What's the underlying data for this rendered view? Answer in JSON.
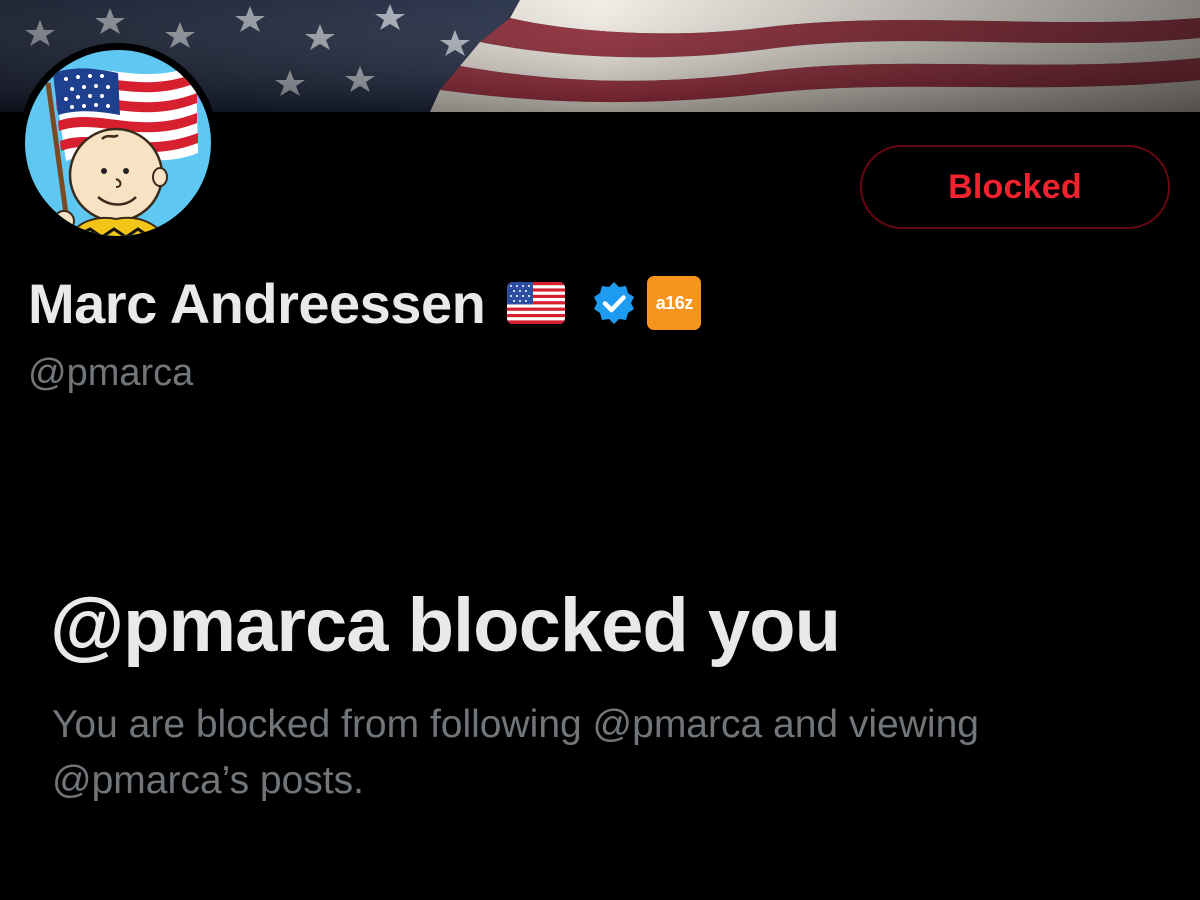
{
  "profile": {
    "display_name": "Marc Andreessen",
    "handle": "@pmarca",
    "verified": true,
    "affiliate_badge_text": "a16z"
  },
  "actions": {
    "blocked_button_label": "Blocked"
  },
  "block_notice": {
    "title": "@pmarca blocked you",
    "description": "You are blocked from following @pmarca and viewing @pmarca’s posts."
  },
  "icons": {
    "flag": "us-flag-emoji",
    "verified": "verified-checkmark-icon",
    "affiliate": "a16z-logo-badge"
  },
  "colors": {
    "background": "#000000",
    "primary_text": "#e7e9ea",
    "secondary_text": "#71767b",
    "blocked_red": "#f4212e",
    "blocked_border": "#67070f",
    "verified_blue": "#1d9bf0",
    "affiliate_orange": "#f7941d"
  }
}
